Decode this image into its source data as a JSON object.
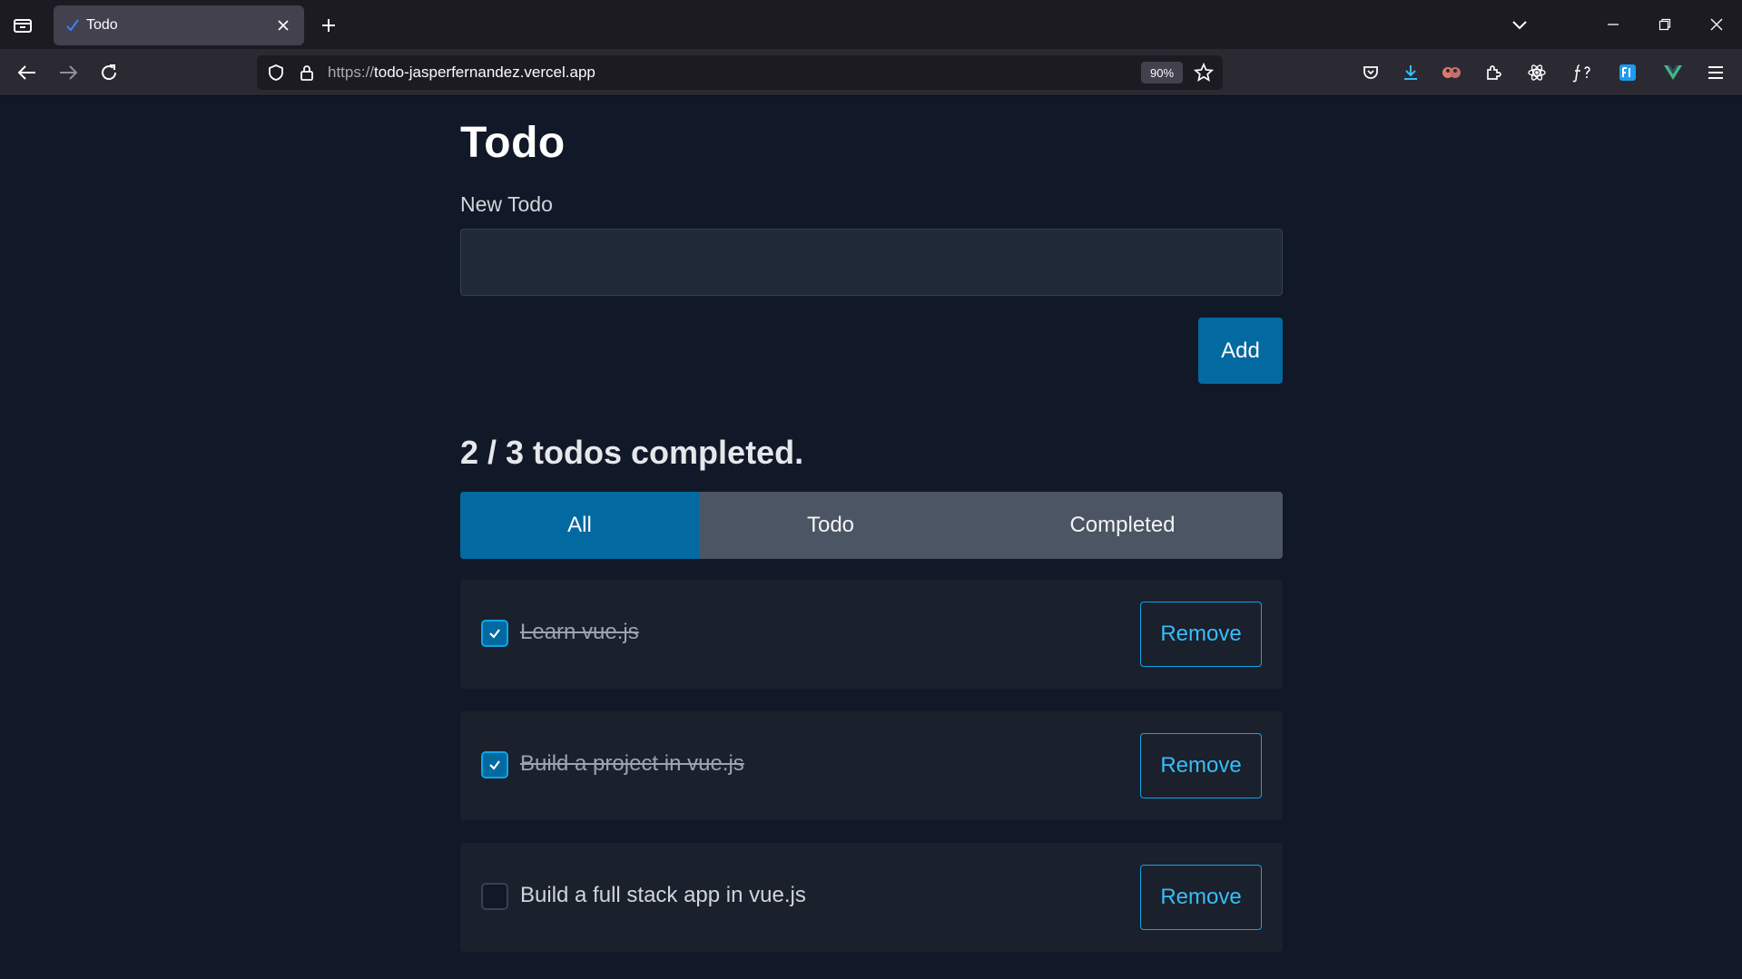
{
  "browser": {
    "tab": {
      "title": "Todo"
    },
    "url": {
      "scheme": "https://",
      "host": "todo-jasperfernandez.vercel.app"
    },
    "zoom": "90%",
    "accent": "#0369a1"
  },
  "app": {
    "title": "Todo",
    "new_todo_label": "New Todo",
    "new_todo_value": "",
    "add_label": "Add",
    "summary": "2 / 3 todos completed.",
    "filters": [
      {
        "label": "All",
        "active": true
      },
      {
        "label": "Todo",
        "active": false
      },
      {
        "label": "Completed",
        "active": false
      }
    ],
    "todos": [
      {
        "text": "Learn vue.js",
        "completed": true,
        "remove_label": "Remove"
      },
      {
        "text": "Build a project in vue.js",
        "completed": true,
        "remove_label": "Remove"
      },
      {
        "text": "Build a full stack app in vue.js",
        "completed": false,
        "remove_label": "Remove"
      }
    ]
  }
}
